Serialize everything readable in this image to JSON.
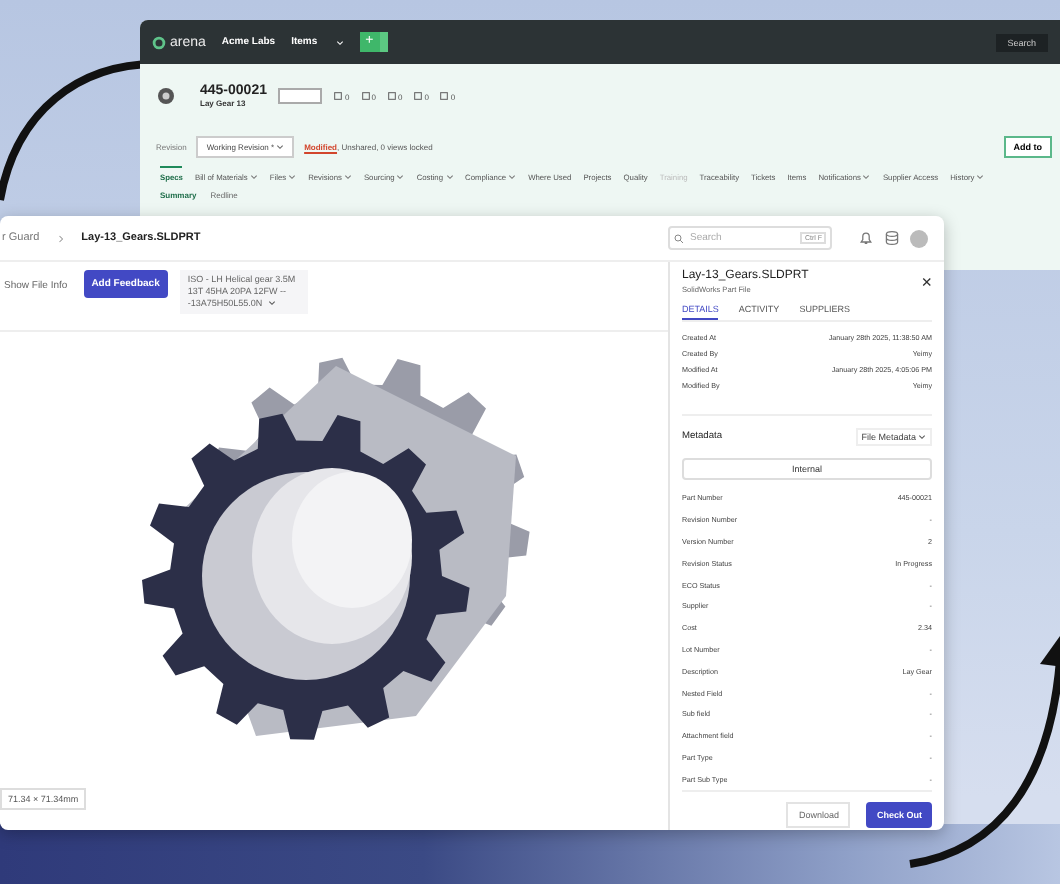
{
  "app_window": {
    "logo": "arena",
    "org": "Acme Labs",
    "items_menu": "Items",
    "add_button": "+",
    "search": "Search",
    "part_number": "445-00021",
    "part_name": "Lay Gear 13",
    "counters": [
      "0",
      "0",
      "0",
      "0",
      "0"
    ],
    "revision_label": "Revision",
    "revision_value": "Working Revision *",
    "status_link": "Modified",
    "status_text": ", Unshared, 0 views locked",
    "add_to_button": "Add to",
    "tabs": [
      {
        "label": "Specs",
        "selected": true,
        "dropdown": false,
        "disabled": false
      },
      {
        "label": "Bill of Materials",
        "selected": false,
        "dropdown": true,
        "disabled": false
      },
      {
        "label": "Files",
        "selected": false,
        "dropdown": true,
        "disabled": false
      },
      {
        "label": "Revisions",
        "selected": false,
        "dropdown": true,
        "disabled": false
      },
      {
        "label": "Sourcing",
        "selected": false,
        "dropdown": true,
        "disabled": false
      },
      {
        "label": "Costing",
        "selected": false,
        "dropdown": true,
        "disabled": false
      },
      {
        "label": "Compliance",
        "selected": false,
        "dropdown": true,
        "disabled": false
      },
      {
        "label": "Where Used",
        "selected": false,
        "dropdown": false,
        "disabled": false
      },
      {
        "label": "Projects",
        "selected": false,
        "dropdown": false,
        "disabled": false
      },
      {
        "label": "Quality",
        "selected": false,
        "dropdown": false,
        "disabled": false
      },
      {
        "label": "Training",
        "selected": false,
        "dropdown": false,
        "disabled": true
      },
      {
        "label": "Traceability",
        "selected": false,
        "dropdown": false,
        "disabled": false
      },
      {
        "label": "Tickets",
        "selected": false,
        "dropdown": false,
        "disabled": false
      },
      {
        "label": "Items",
        "selected": false,
        "dropdown": false,
        "disabled": false
      },
      {
        "label": "Notifications",
        "selected": false,
        "dropdown": true,
        "disabled": false
      },
      {
        "label": "Supplier Access",
        "selected": false,
        "dropdown": false,
        "disabled": false
      },
      {
        "label": "History",
        "selected": false,
        "dropdown": true,
        "disabled": false
      }
    ],
    "subtabs": [
      {
        "label": "Summary",
        "selected": true
      },
      {
        "label": "Redline",
        "selected": false
      }
    ]
  },
  "viewer_window": {
    "breadcrumb": [
      "r Guard",
      "Lay-13_Gears.SLDPRT"
    ],
    "search": {
      "placeholder": "Search",
      "shortcut": "Ctrl F"
    },
    "show_file_info": "Show File Info",
    "add_feedback": "Add Feedback",
    "configuration": "ISO - LH Helical gear 3.5M 13T 45HA 20PA 12FW -- -13A75H50L55.0N",
    "dimensions": "71.34 × 71.34mm",
    "panel": {
      "title": "Lay-13_Gears.SLDPRT",
      "subtitle": "SolidWorks Part File",
      "close": "×",
      "tabs": [
        {
          "label": "DETAILS",
          "selected": true
        },
        {
          "label": "ACTIVITY",
          "selected": false
        },
        {
          "label": "SUPPLIERS",
          "selected": false
        }
      ],
      "details": [
        {
          "label": "Created At",
          "value": "January 28th 2025, 11:38:50 AM"
        },
        {
          "label": "Created By",
          "value": "Yeimy"
        },
        {
          "label": "Modified At",
          "value": "January 28th 2025, 4:05:06 PM"
        },
        {
          "label": "Modified By",
          "value": "Yeimy"
        }
      ],
      "metadata_title": "Metadata",
      "metadata_menu": "File Metadata",
      "metadata_scope": "Internal",
      "metadata": [
        {
          "label": "Part Number",
          "value": "445-00021"
        },
        {
          "label": "Revision Number",
          "value": "-"
        },
        {
          "label": "Version Number",
          "value": "2"
        },
        {
          "label": "Revision Status",
          "value": "In Progress"
        },
        {
          "label": "ECO Status",
          "value": "-"
        },
        {
          "label": "Supplier",
          "value": "-"
        },
        {
          "label": "Cost",
          "value": "2.34"
        },
        {
          "label": "Lot Number",
          "value": "-"
        },
        {
          "label": "Description",
          "value": "Lay Gear"
        },
        {
          "label": "Nested Field",
          "value": "-"
        },
        {
          "label": "Sub field",
          "value": "-"
        },
        {
          "label": "Attachment field",
          "value": "-"
        },
        {
          "label": "Part Type",
          "value": "-"
        },
        {
          "label": "Part Sub Type",
          "value": "-"
        }
      ],
      "buttons": [
        "Download",
        "Check Out"
      ]
    }
  }
}
